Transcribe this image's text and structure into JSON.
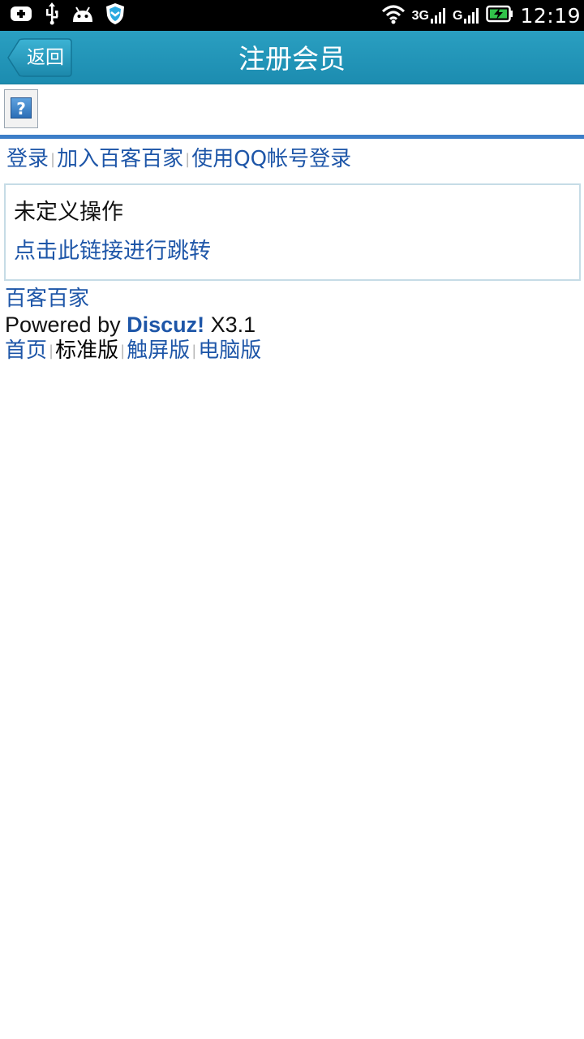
{
  "status_bar": {
    "time": "12:19",
    "network_1": "3G",
    "network_2": "G",
    "icons": [
      "add-notification-icon",
      "usb-icon",
      "android-debug-icon",
      "security-shield-icon",
      "wifi-icon",
      "signal-icon",
      "battery-charging-icon"
    ]
  },
  "header": {
    "back_label": "返回",
    "title": "注册会员"
  },
  "nav": {
    "login": "登录",
    "join": "加入百客百家",
    "qq_login": "使用QQ帐号登录",
    "separator": "|"
  },
  "message": {
    "text": "未定义操作",
    "link": "点击此链接进行跳转"
  },
  "footer": {
    "site_name": "百客百家",
    "powered_prefix": "Powered by",
    "brand": "Discuz!",
    "version": "X3.1",
    "links": {
      "home": "首页",
      "standard": "标准版",
      "touch": "触屏版",
      "desktop": "电脑版"
    }
  },
  "colors": {
    "header_bg": "#1e90b4",
    "link": "#1e56a8",
    "rule": "#3d7ec8",
    "box_border": "#c6dce6"
  }
}
